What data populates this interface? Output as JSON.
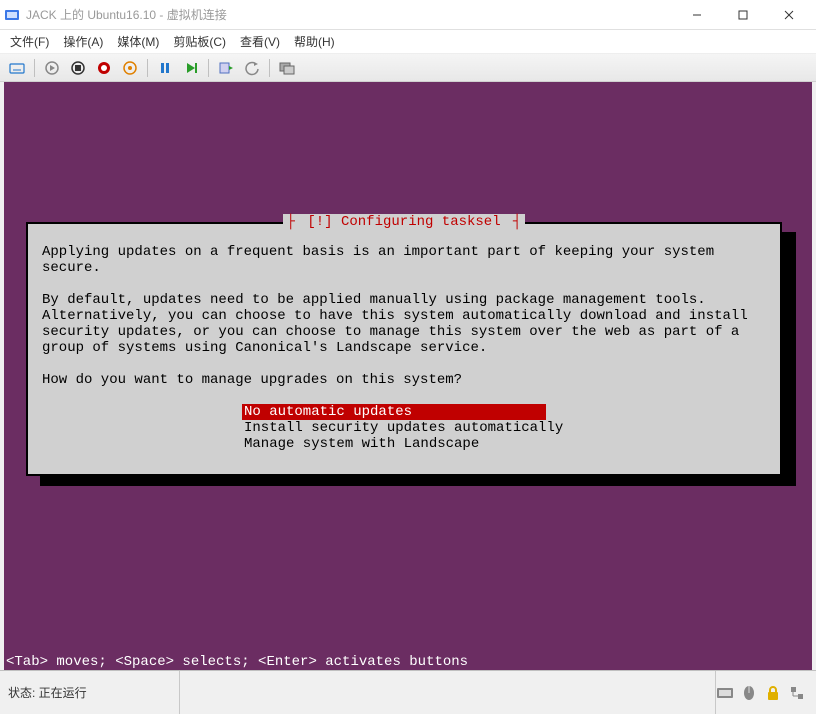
{
  "window": {
    "title": "JACK 上的 Ubuntu16.10 - 虚拟机连接"
  },
  "menu": {
    "file": "文件(F)",
    "action": "操作(A)",
    "media": "媒体(M)",
    "clipboard": "剪贴板(C)",
    "view": "查看(V)",
    "help": "帮助(H)"
  },
  "dialog": {
    "title": "[!] Configuring tasksel",
    "para1": "Applying updates on a frequent basis is an important part of keeping your system secure.",
    "para2": "By default, updates need to be applied manually using package management tools. Alternatively, you can choose to have this system automatically download and install security updates, or you can choose to manage this system over the web as part of a group of systems using Canonical's Landscape service.",
    "question": "How do you want to manage upgrades on this system?",
    "options": [
      "No automatic updates",
      "Install security updates automatically",
      "Manage system with Landscape"
    ]
  },
  "helpbar": "<Tab> moves; <Space> selects; <Enter> activates buttons",
  "status": {
    "label": "状态: 正在运行"
  }
}
